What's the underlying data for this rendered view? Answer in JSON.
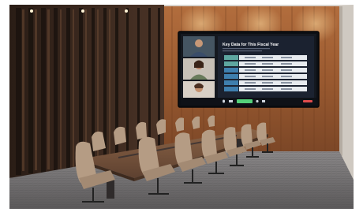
{
  "screen": {
    "slide_title": "Key Data for This Fiscal Year",
    "table_rows": [
      {
        "col1": "",
        "col2": "",
        "col3": "",
        "col4": ""
      },
      {
        "col1": "",
        "col2": "",
        "col3": "",
        "col4": ""
      },
      {
        "col1": "",
        "col2": "",
        "col3": "",
        "col4": ""
      },
      {
        "col1": "",
        "col2": "",
        "col3": "",
        "col4": ""
      },
      {
        "col1": "",
        "col2": "",
        "col3": "",
        "col4": ""
      },
      {
        "col1": "",
        "col2": "",
        "col3": "",
        "col4": ""
      }
    ],
    "participants": [
      "participant-1",
      "participant-2",
      "participant-3"
    ],
    "footer_status": ""
  },
  "colors": {
    "wood_wall": "#a4653a",
    "dark_panel": "#3a2a20",
    "carpet": "#6f6d6e",
    "chair": "#b59c84",
    "table_top": "#7a563c",
    "screen_bg": "#14181f",
    "teal_row": "#5ea6a0",
    "blue_row": "#3f7fae",
    "accent_green": "#55d17a",
    "accent_red": "#e04c4c"
  },
  "icons": [
    "mic-icon",
    "camera-icon",
    "share-screen-icon",
    "participants-icon",
    "chat-icon",
    "leave-icon"
  ]
}
